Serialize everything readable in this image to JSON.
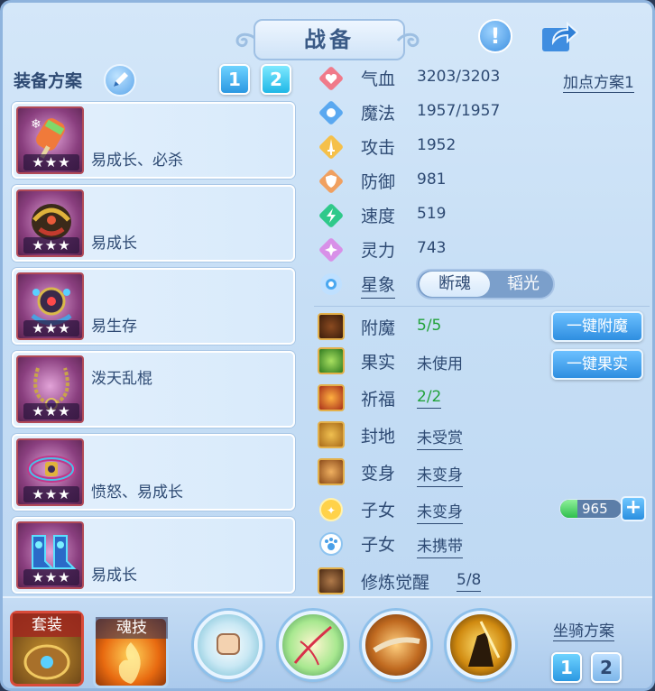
{
  "header": {
    "title": "战备"
  },
  "left": {
    "plan_label": "装备方案",
    "plan_buttons": [
      "1",
      "2"
    ],
    "equipment": [
      {
        "desc": "易成长、必杀",
        "stars": "★★★",
        "icon": "popsicle-equip-icon"
      },
      {
        "desc": "易成长",
        "stars": "★★★",
        "icon": "helmet-equip-icon"
      },
      {
        "desc": "易生存",
        "stars": "★★★",
        "icon": "amulet-equip-icon"
      },
      {
        "desc": "泼天乱棍",
        "stars": "★★★",
        "icon": "necklace-equip-icon"
      },
      {
        "desc": "愤怒、易成长",
        "stars": "★★★",
        "icon": "belt-equip-icon"
      },
      {
        "desc": "易成长",
        "stars": "★★★",
        "icon": "boots-equip-icon"
      }
    ]
  },
  "stats": {
    "hp": {
      "label": "气血",
      "value": "3203/3203"
    },
    "mp": {
      "label": "魔法",
      "value": "1957/1957"
    },
    "atk": {
      "label": "攻击",
      "value": "1952"
    },
    "def": {
      "label": "防御",
      "value": "981"
    },
    "spd": {
      "label": "速度",
      "value": "519"
    },
    "spirit": {
      "label": "灵力",
      "value": "743"
    },
    "point_plan": "加点方案1"
  },
  "star_sign": {
    "label": "星象",
    "options": [
      "断魂",
      "韬光"
    ],
    "selected": "断魂"
  },
  "attributes": {
    "enchant": {
      "label": "附魔",
      "value": "5/5"
    },
    "fruit": {
      "label": "果实",
      "value": "未使用"
    },
    "blessing": {
      "label": "祈福",
      "value": "2/2"
    },
    "fief": {
      "label": "封地",
      "value": "未受赏"
    },
    "transform": {
      "label": "变身",
      "value": "未变身"
    },
    "child1": {
      "label": "子女",
      "value": "未变身"
    },
    "child2": {
      "label": "子女",
      "value": "未携带"
    },
    "awaken": {
      "label": "修炼觉醒",
      "value": "5/8"
    },
    "child_points": "965"
  },
  "buttons": {
    "one_click_enchant": "一键附魔",
    "one_click_fruit": "一键果实"
  },
  "bottom": {
    "set_label": "套装",
    "soul_label": "魂技",
    "mount_label": "坐骑方案",
    "mount_buttons": [
      "1",
      "2"
    ]
  },
  "colors": {
    "panel_bg": "#c6def5",
    "text": "#2e4a73",
    "accent_blue": "#2e8ee0",
    "green_value": "#22a23a",
    "star_badge": "#3d2a4a"
  }
}
